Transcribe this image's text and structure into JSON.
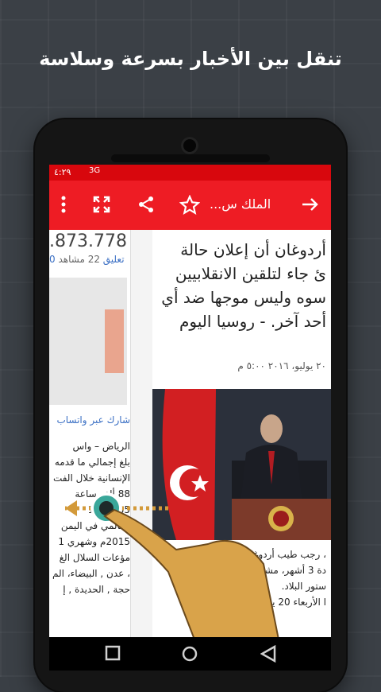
{
  "promo": {
    "headline": "تنقل بين الأخبار بسرعة وسلاسة"
  },
  "statusbar": {
    "time": "٤:٢٩",
    "network": "3G"
  },
  "toolbar": {
    "title": "الملك س...",
    "icons": [
      "back-arrow-icon",
      "star-icon",
      "share-icon",
      "fullscreen-icon",
      "more-vert-icon"
    ]
  },
  "left_article": {
    "big_number": ".873.778",
    "stats_link": "0 تعليق",
    "stats_views": "22 مشاهد",
    "share_text": "شارك عبر واتساب",
    "body_lines": [
      "الرياض – واس",
      "بلغ إجمالي ما قدمه",
      "الإنسانية خلال الفت",
      "88 ألف ساعة",
      "1.030.35",
      "العالمي في اليمن",
      "2015م وشهري 1",
      "مؤعات السلال الغ",
      "، عدن , البيضاء، الم",
      "حجة , الحديدة , إ"
    ]
  },
  "right_article": {
    "title_lines": [
      "أردوغان أن إعلان حالة",
      "ئ جاء لتلقين الانقلابيين",
      "سوه وليس موجها ضد أي",
      "أحد آخر. - روسيا اليوم"
    ],
    "date": "٢٠ يوليو، ٢٠١٦ ٥:٠٠ م",
    "caption_lines": [
      "، رجب طيب أردوغان",
      "دة 3 أشهر، مشيرا إلى",
      "ستور البلاد.",
      "ا الأربعاء 20 يوليو"
    ]
  }
}
